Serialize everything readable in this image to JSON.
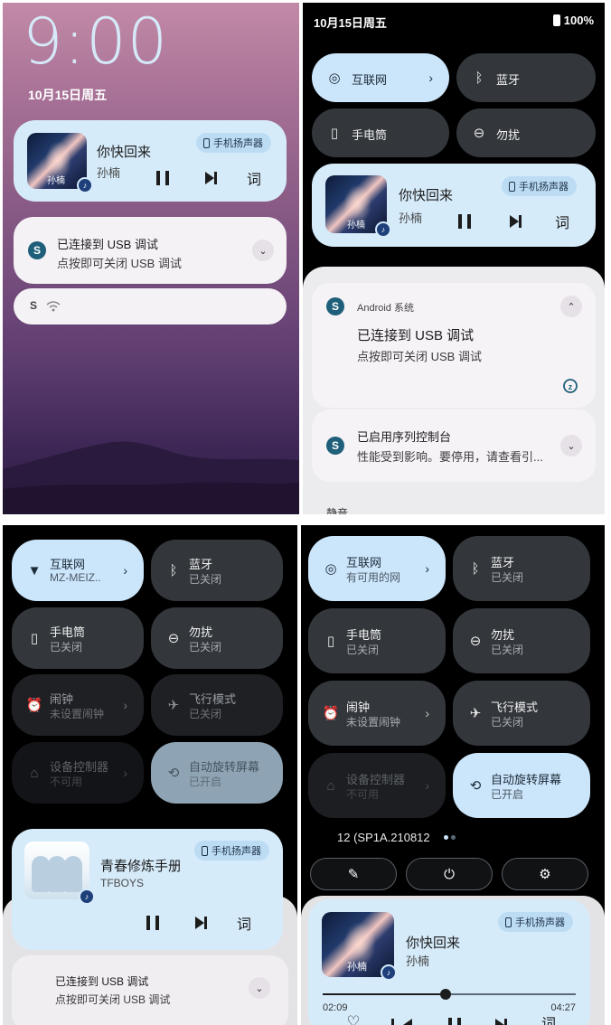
{
  "panel1": {
    "clock": "9:00",
    "date": "10月15日周五",
    "media": {
      "title": "你快回来",
      "artist": "孙楠",
      "output": "手机扬声器",
      "lyric_label": "词",
      "art_text": "孙楠"
    },
    "usb": {
      "title": "已连接到 USB 调试",
      "subtitle": "点按即可关闭 USB 调试"
    }
  },
  "panel2": {
    "date": "10月15日周五",
    "battery": "100%",
    "tiles": [
      {
        "label": "互联网",
        "icon": "globe-icon"
      },
      {
        "label": "蓝牙",
        "icon": "bluetooth-icon"
      },
      {
        "label": "手电筒",
        "icon": "flashlight-icon"
      },
      {
        "label": "勿扰",
        "icon": "dnd-icon"
      }
    ],
    "media": {
      "title": "你快回来",
      "artist": "孙楠",
      "output": "手机扬声器",
      "lyric_label": "词",
      "art_text": "孙楠"
    },
    "notif1": {
      "app": "Android 系统",
      "title": "已连接到 USB 调试",
      "subtitle": "点按即可关闭 USB 调试"
    },
    "notif2": {
      "title": "已启用序列控制台",
      "subtitle": "性能受到影响。要停用，请查看引..."
    },
    "cut_label": "静音"
  },
  "panel3": {
    "tiles": [
      {
        "label": "互联网",
        "sub": "MZ-MEIZ..",
        "icon": "wifi-icon"
      },
      {
        "label": "蓝牙",
        "sub": "已关闭",
        "icon": "bluetooth-icon"
      },
      {
        "label": "手电筒",
        "sub": "已关闭",
        "icon": "flashlight-icon"
      },
      {
        "label": "勿扰",
        "sub": "已关闭",
        "icon": "dnd-icon"
      },
      {
        "label": "闹钟",
        "sub": "未设置闹钟",
        "icon": "alarm-icon"
      },
      {
        "label": "飞行模式",
        "sub": "已关闭",
        "icon": "airplane-icon"
      },
      {
        "label": "设备控制器",
        "sub": "不可用",
        "icon": "home-icon"
      },
      {
        "label": "自动旋转屏幕",
        "sub": "已开启",
        "icon": "rotate-icon"
      }
    ],
    "media": {
      "title": "青春修炼手册",
      "artist": "TFBOYS",
      "output": "手机扬声器",
      "lyric_label": "词"
    },
    "usb": {
      "title": "已连接到 USB 调试",
      "subtitle": "点按即可关闭 USB 调试"
    }
  },
  "panel4": {
    "tiles": [
      {
        "label": "互联网",
        "sub": "有可用的网",
        "icon": "globe-icon"
      },
      {
        "label": "蓝牙",
        "sub": "已关闭",
        "icon": "bluetooth-icon"
      },
      {
        "label": "手电筒",
        "sub": "已关闭",
        "icon": "flashlight-icon"
      },
      {
        "label": "勿扰",
        "sub": "已关闭",
        "icon": "dnd-icon"
      },
      {
        "label": "闹钟",
        "sub": "未设置闹钟",
        "icon": "alarm-icon"
      },
      {
        "label": "飞行模式",
        "sub": "已关闭",
        "icon": "airplane-icon"
      },
      {
        "label": "设备控制器",
        "sub": "不可用",
        "icon": "home-icon"
      },
      {
        "label": "自动旋转屏幕",
        "sub": "已开启",
        "icon": "rotate-icon"
      }
    ],
    "build": "12 (SP1A.210812",
    "media": {
      "title": "你快回来",
      "artist": "孙楠",
      "output": "手机扬声器",
      "elapsed": "02:09",
      "duration": "04:27",
      "progress": 0.485,
      "lyric_label": "词",
      "art_text": "孙楠"
    }
  },
  "colors": {
    "tile_on": "#cbe5fa",
    "tile_off": "#33373c",
    "media_bg": "#d6ebfa",
    "usb_icon": "#1f5f79"
  }
}
